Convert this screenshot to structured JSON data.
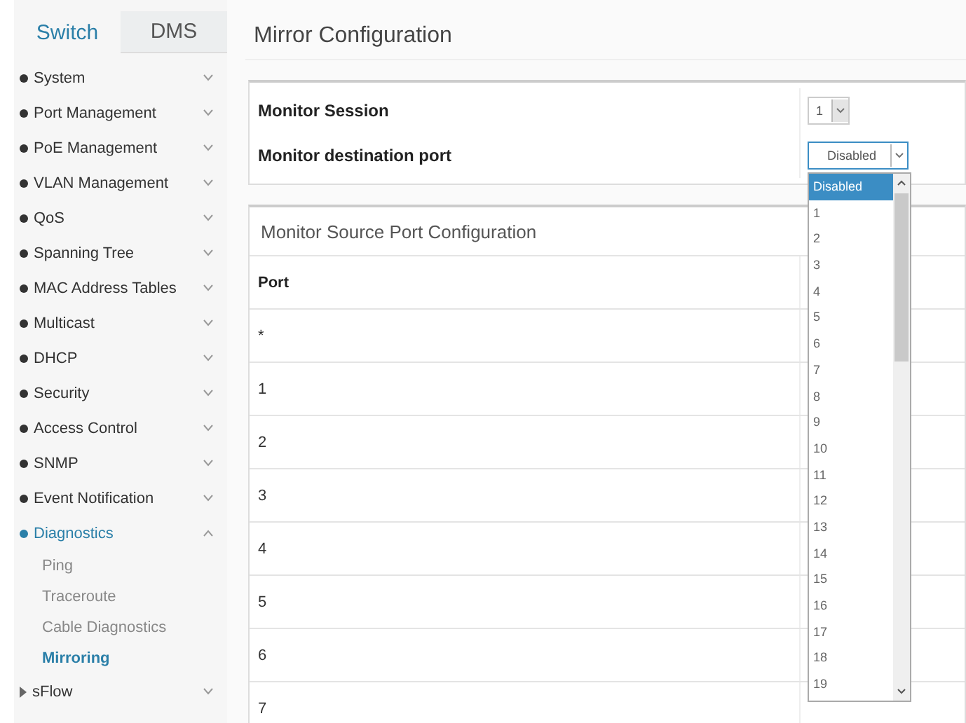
{
  "tabs": [
    {
      "label": "Switch",
      "selected": true
    },
    {
      "label": "DMS",
      "selected": false
    }
  ],
  "sidebar": {
    "items": [
      {
        "label": "System",
        "kind": "bullet",
        "expanded": false,
        "selected": false
      },
      {
        "label": "Port Management",
        "kind": "bullet",
        "expanded": false,
        "selected": false
      },
      {
        "label": "PoE Management",
        "kind": "bullet",
        "expanded": false,
        "selected": false
      },
      {
        "label": "VLAN Management",
        "kind": "bullet",
        "expanded": false,
        "selected": false
      },
      {
        "label": "QoS",
        "kind": "bullet",
        "expanded": false,
        "selected": false
      },
      {
        "label": "Spanning Tree",
        "kind": "bullet",
        "expanded": false,
        "selected": false
      },
      {
        "label": "MAC Address Tables",
        "kind": "bullet",
        "expanded": false,
        "selected": false
      },
      {
        "label": "Multicast",
        "kind": "bullet",
        "expanded": false,
        "selected": false
      },
      {
        "label": "DHCP",
        "kind": "bullet",
        "expanded": false,
        "selected": false
      },
      {
        "label": "Security",
        "kind": "bullet",
        "expanded": false,
        "selected": false
      },
      {
        "label": "Access Control",
        "kind": "bullet",
        "expanded": false,
        "selected": false
      },
      {
        "label": "SNMP",
        "kind": "bullet",
        "expanded": false,
        "selected": false
      },
      {
        "label": "Event Notification",
        "kind": "bullet",
        "expanded": false,
        "selected": false
      },
      {
        "label": "Diagnostics",
        "kind": "bullet",
        "expanded": true,
        "selected": true,
        "children": [
          {
            "label": "Ping",
            "selected": false
          },
          {
            "label": "Traceroute",
            "selected": false
          },
          {
            "label": "Cable Diagnostics",
            "selected": false
          },
          {
            "label": "Mirroring",
            "selected": true
          }
        ]
      },
      {
        "label": "sFlow",
        "kind": "arrow",
        "expanded": false,
        "selected": false
      }
    ]
  },
  "page_title": "Mirror Configuration",
  "settings": [
    {
      "label": "Monitor Session",
      "value": "1",
      "open": false
    },
    {
      "label": "Monitor destination port",
      "value": "Disabled",
      "open": true
    }
  ],
  "dropdown_options": [
    {
      "label": "Disabled",
      "selected": true
    },
    {
      "label": "1",
      "selected": false
    },
    {
      "label": "2",
      "selected": false
    },
    {
      "label": "3",
      "selected": false
    },
    {
      "label": "4",
      "selected": false
    },
    {
      "label": "5",
      "selected": false
    },
    {
      "label": "6",
      "selected": false
    },
    {
      "label": "7",
      "selected": false
    },
    {
      "label": "8",
      "selected": false
    },
    {
      "label": "9",
      "selected": false
    },
    {
      "label": "10",
      "selected": false
    },
    {
      "label": "11",
      "selected": false
    },
    {
      "label": "12",
      "selected": false
    },
    {
      "label": "13",
      "selected": false
    },
    {
      "label": "14",
      "selected": false
    },
    {
      "label": "15",
      "selected": false
    },
    {
      "label": "16",
      "selected": false
    },
    {
      "label": "17",
      "selected": false
    },
    {
      "label": "18",
      "selected": false
    },
    {
      "label": "19",
      "selected": false
    }
  ],
  "source_section": {
    "title": "Monitor Source Port Configuration",
    "columns": [
      "Port"
    ],
    "rows": [
      "*",
      "1",
      "2",
      "3",
      "4",
      "5",
      "6",
      "7"
    ]
  }
}
